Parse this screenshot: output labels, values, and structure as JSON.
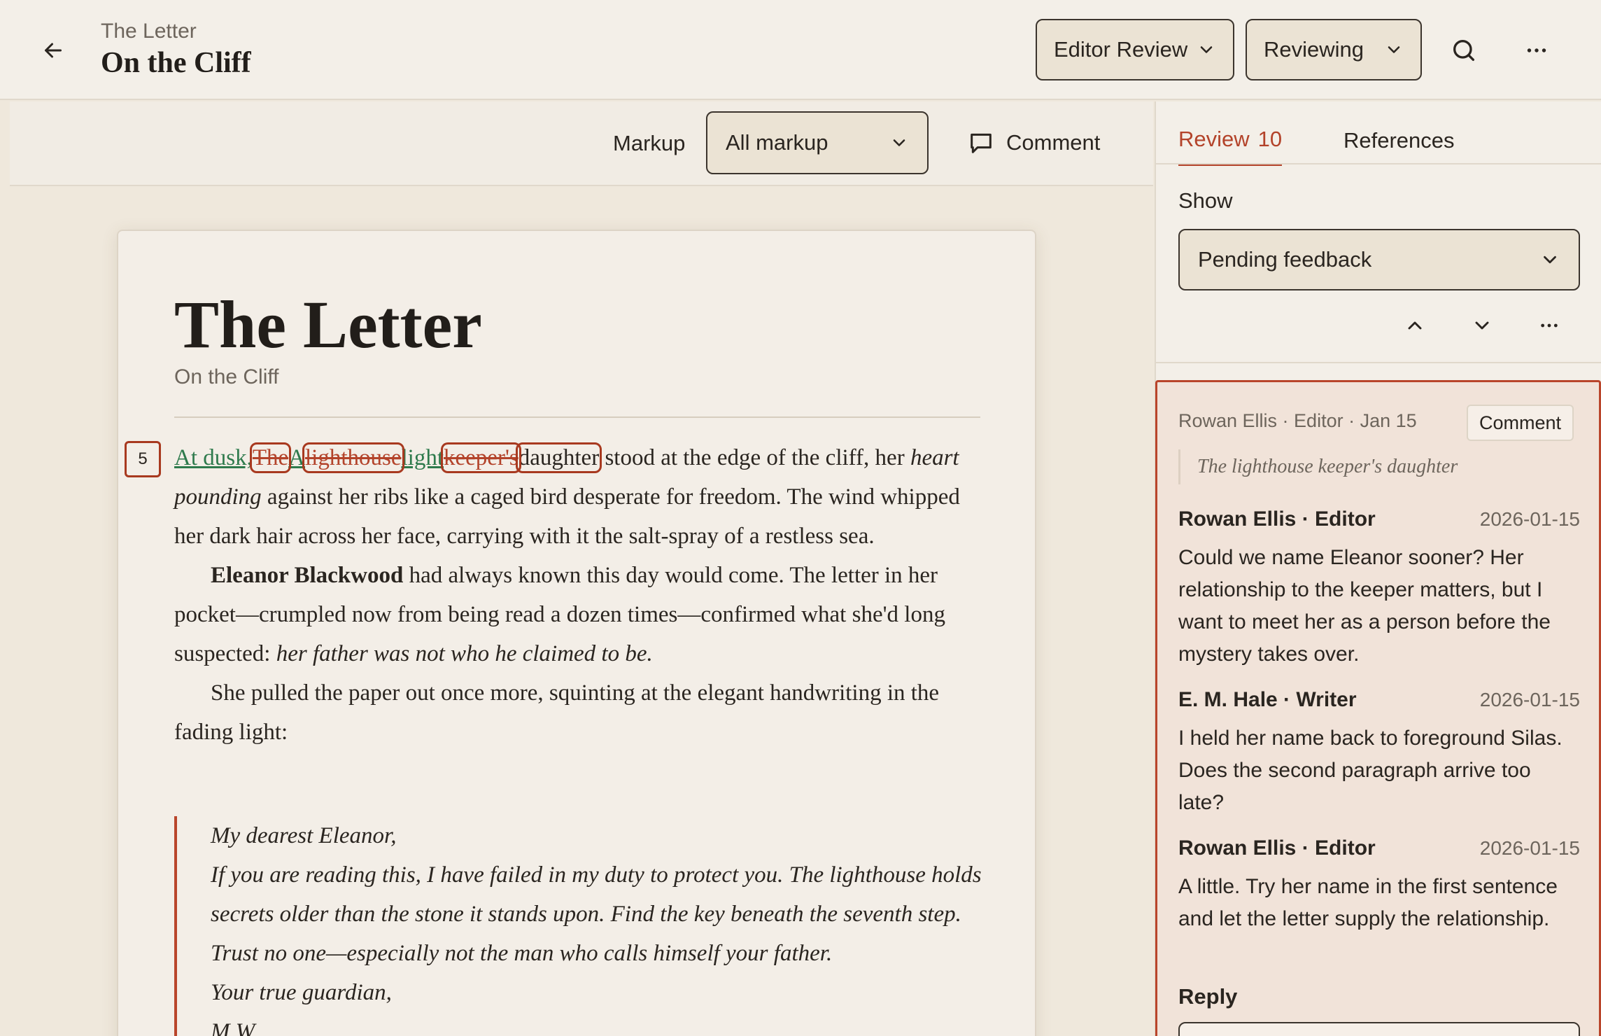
{
  "header": {
    "parent": "The Letter",
    "title": "On the Cliff",
    "mode_label": "Editor Review",
    "status_label": "Reviewing"
  },
  "toolbar": {
    "markup_label": "Markup",
    "markup_value": "All markup",
    "comment_label": "Comment"
  },
  "document": {
    "title": "The Letter",
    "subtitle": "On the Cliff",
    "change_number": "5",
    "p1": {
      "ins1": "At dusk,",
      "del1": "The",
      "ins2": "A",
      "del2": "lighthouse",
      "ins3": "light",
      "del3": "keeper's",
      "word": "daughter",
      "rest": " stood at the edge of the cliff, her ",
      "italic": "heart pounding",
      "rest2": " against her ribs like a caged bird desperate for freedom. The wind whipped her dark hair across her face, carrying with it the salt-spray of a restless sea."
    },
    "p2": {
      "bold": "Eleanor Blackwood",
      "text": " had always known this day would come. The letter in her pocket—crumpled now from being read a dozen times—confirmed what she'd long suspected: ",
      "italic": "her father was not who he claimed to be."
    },
    "p3": "She pulled the paper out once more, squinting at the elegant handwriting in the fading light:",
    "letter": {
      "greeting": "My dearest Eleanor,",
      "line1": "If you are reading this, I have failed in my duty to protect you. The lighthouse holds secrets older than the stone it stands upon. Find the key beneath the seventh step.",
      "line2": "Trust no one—especially not the man who calls himself your father.",
      "closing": "Your true guardian,",
      "signature": "M.W."
    }
  },
  "panel": {
    "tab_review": "Review",
    "tab_review_count": "10",
    "tab_references": "References",
    "show_label": "Show",
    "show_value": "Pending feedback"
  },
  "thread": {
    "meta": "Rowan Ellis · Editor · Jan 15",
    "tag": "Comment",
    "quote": "The lighthouse keeper's daughter",
    "messages": [
      {
        "author": "Rowan Ellis · Editor",
        "date": "2026-01-15",
        "body": "Could we name Eleanor sooner? Her relationship to the keeper matters, but I want to meet her as a person before the mystery takes over."
      },
      {
        "author": "E. M. Hale · Writer",
        "date": "2026-01-15",
        "body": "I held her name back to foreground Silas. Does the second paragraph arrive too late?"
      },
      {
        "author": "Rowan Ellis · Editor",
        "date": "2026-01-15",
        "body": "A little. Try her name in the first sentence and let the letter supply the relationship."
      }
    ],
    "reply_label": "Reply"
  },
  "colors": {
    "accent": "#b3432a",
    "insert": "#2e7a4c",
    "background": "#efe8dc"
  }
}
